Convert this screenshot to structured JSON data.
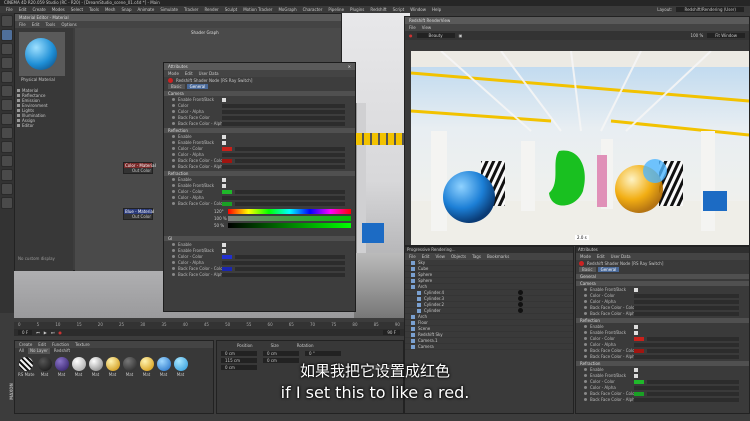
{
  "main_window": {
    "title": "CINEMA 4D R20.059 Studio (RC - R20) - [DreamStudio_scene_01.c4d *] - Main",
    "menu": [
      "File",
      "Edit",
      "Create",
      "Modes",
      "Select",
      "Tools",
      "Mesh",
      "Snap",
      "Animate",
      "Simulate",
      "Tracker",
      "Render",
      "Sculpt",
      "Motion Tracker",
      "MoGraph",
      "Character",
      "Pipeline",
      "Plugins",
      "Redshift",
      "Script",
      "Window",
      "Help"
    ],
    "layout_label": "Layout:",
    "layout_value": "Redshift/Rendering (User)"
  },
  "material_editor": {
    "title": "Material Editor - Material",
    "menu": [
      "File",
      "Edit",
      "Tools",
      "Options"
    ],
    "preview_label": "Physical Material",
    "tree_items": [
      "Material",
      "Reflectance",
      "Emission",
      "Environment",
      "Lights",
      "Illumination",
      "Assign",
      "Editor"
    ],
    "status": "No custom display"
  },
  "shader_graph": {
    "title": "Shader Graph",
    "node_red": {
      "title": "Color - Material",
      "port": "Out Color"
    },
    "node_blue": {
      "title": "Blue - Material",
      "port": "Out Color"
    }
  },
  "attributes_popup": {
    "title": "Attributes",
    "menu": [
      "Mode",
      "Edit",
      "User Data"
    ],
    "header": "Redshift Shader Node [RS Ray Switch]",
    "tabs": [
      "Basic",
      "General"
    ],
    "sections": [
      {
        "name": "Camera",
        "rows": [
          "Enable Front/Back",
          "Color",
          "Color - Alpha",
          "Back Face Color",
          "Back Face Color - Alpha"
        ]
      },
      {
        "name": "Reflection",
        "rows": [
          "Enable",
          "Enable Front/Back",
          "Color - Color",
          "Color - Alpha",
          "Back Face Color - Color",
          "Back Face Color - Alpha"
        ]
      },
      {
        "name": "Refraction",
        "rows": [
          "Enable",
          "Enable Front/Back",
          "Color - Color",
          "Color - Alpha",
          "Back Face Color - Color"
        ]
      },
      {
        "name": "GI",
        "rows": [
          "Enable",
          "Enable Front/Back",
          "Color - Color",
          "Color - Alpha",
          "Back Face Color - Color",
          "Back Face Color - Alpha"
        ]
      }
    ],
    "color_picker": {
      "h": "120°",
      "s": "100 %",
      "v": "50 %"
    }
  },
  "render_view": {
    "title": "Redshift RenderView",
    "menu": [
      "File",
      "View"
    ],
    "mode_value": "Beauty",
    "zoom_value": "100 %",
    "status": "Progressive Rendering...",
    "render_time": "2.0 s",
    "fit_window": "Fit Window"
  },
  "object_manager": {
    "menu": [
      "File",
      "Edit",
      "View",
      "Objects",
      "Tags",
      "Bookmarks"
    ],
    "items": [
      "Sky",
      "Cube",
      "Sphere",
      "Sphere",
      "Arch",
      "Cylinder.4",
      "Cylinder.3",
      "Cylinder.2",
      "Cylinder",
      "Arch",
      "Floor",
      "Scene",
      "Redshift Sky",
      "Camera.1",
      "Camera"
    ]
  },
  "attributes_right": {
    "title": "Attributes",
    "menu": [
      "Mode",
      "Edit",
      "User Data"
    ],
    "header": "Redshift Shader Node [RS Ray Switch]",
    "tabs": [
      "Basic",
      "General"
    ],
    "sections": [
      {
        "name": "General",
        "rows": []
      },
      {
        "name": "Camera",
        "rows": [
          "Enable Front/Back",
          "Color - Color",
          "Color - Alpha",
          "Back Face Color - Color",
          "Back Face Color - Alpha"
        ]
      },
      {
        "name": "Reflection",
        "rows": [
          "Enable",
          "Enable Front/Back",
          "Color - Color",
          "Color - Alpha",
          "Back Face Color - Color",
          "Back Face Color - Alpha"
        ]
      },
      {
        "name": "Refraction",
        "rows": [
          "Enable",
          "Enable Front/Back",
          "Color - Color",
          "Color - Alpha",
          "Back Face Color - Color",
          "Back Face Color - Alpha"
        ]
      }
    ]
  },
  "coordinates": {
    "labels": [
      "Position",
      "Size",
      "Rotation"
    ],
    "x": "0 cm",
    "y": "115 cm",
    "z": "0 cm",
    "size_x": "0 cm",
    "size_y": "0 cm",
    "rot_h": "0 °",
    "apply": "Apply"
  },
  "timeline": {
    "ticks": [
      "0",
      "5",
      "10",
      "15",
      "20",
      "25",
      "30",
      "35",
      "40",
      "45",
      "50",
      "55",
      "60",
      "65",
      "70",
      "75",
      "80",
      "85",
      "90"
    ],
    "start": "0 F",
    "end": "90 F"
  },
  "materials_panel": {
    "menu": [
      "Create",
      "Edit",
      "Function",
      "Texture"
    ],
    "filter": [
      "All",
      "No Layer",
      "Redshift"
    ],
    "labels": [
      "RS Mate",
      "Mat",
      "Mat",
      "Mat",
      "Mat",
      "Mat",
      "Mat",
      "Mat",
      "Mat",
      "Mat"
    ]
  },
  "subtitles": {
    "zh": "如果我把它设置成红色",
    "en": "if I set this to like a red."
  },
  "brand": "MAXON",
  "colors": {
    "red_swatch": "#c8201a",
    "green_swatch": "#1fb82a",
    "blue_swatch": "#2230d0",
    "ui_dark": "#2f2f2f"
  }
}
